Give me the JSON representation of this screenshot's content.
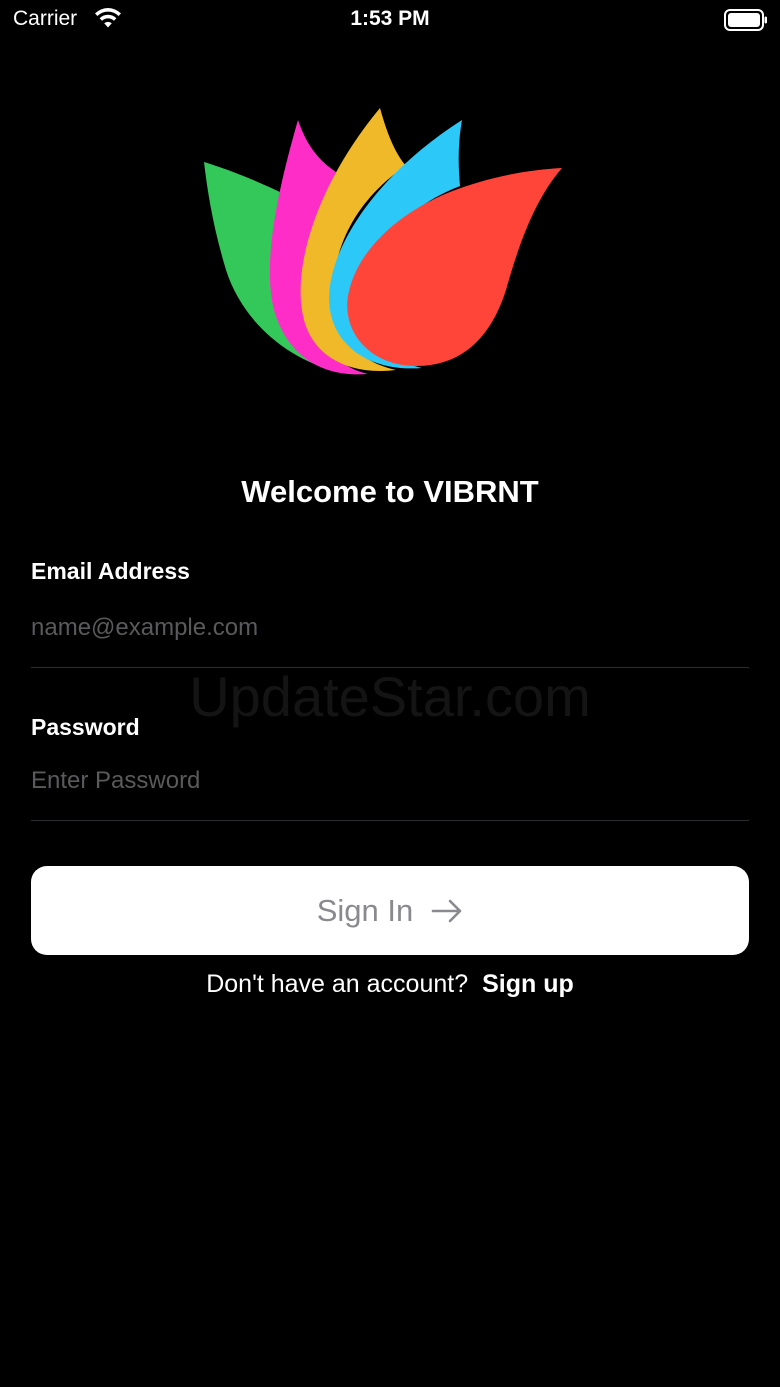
{
  "status_bar": {
    "carrier": "Carrier",
    "time": "1:53 PM"
  },
  "icons": {
    "wifi": "wifi-icon",
    "battery": "battery-icon",
    "logo": "lotus-logo-icon",
    "arrow": "arrow-right-icon"
  },
  "logo_colors": [
    "#34c759",
    "#ff2dc8",
    "#f0b92a",
    "#2bc8f8",
    "#ff453a"
  ],
  "welcome": {
    "title": "Welcome to VIBRNT"
  },
  "form": {
    "email": {
      "label": "Email Address",
      "placeholder": "name@example.com",
      "value": ""
    },
    "password": {
      "label": "Password",
      "placeholder": "Enter Password",
      "value": ""
    },
    "signin_label": "Sign In"
  },
  "footer": {
    "prompt": "Don't have an account?",
    "signup_label": "Sign up"
  },
  "watermark": "UpdateStar.com",
  "colors": {
    "background": "#000000",
    "button_bg": "#ffffff",
    "button_text": "#8a8a8e",
    "placeholder": "#5a5a5c",
    "divider": "#2c2c2e"
  }
}
